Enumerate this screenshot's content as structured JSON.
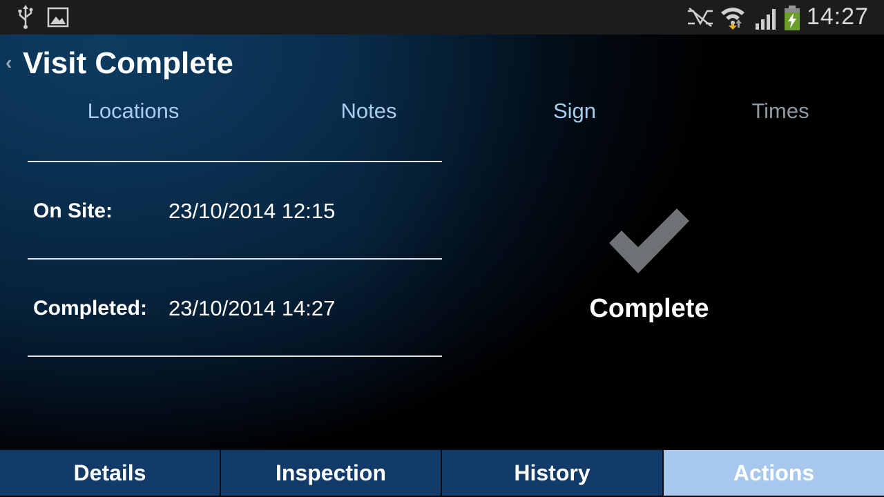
{
  "status_bar": {
    "time": "14:27",
    "icons": [
      "usb-icon",
      "image-icon",
      "nfc-muted-icon",
      "wifi-icon",
      "signal-icon",
      "battery-charging-icon"
    ]
  },
  "header": {
    "title": "Visit Complete",
    "back_glyph": "‹"
  },
  "top_tabs": [
    {
      "label": "Locations",
      "state": "enabled"
    },
    {
      "label": "Notes",
      "state": "enabled"
    },
    {
      "label": "Sign",
      "state": "enabled"
    },
    {
      "label": "Times",
      "state": "disabled"
    }
  ],
  "times": {
    "on_site": {
      "label": "On Site:",
      "value": "23/10/2014 12:15"
    },
    "completed": {
      "label": "Completed:",
      "value": "23/10/2014 14:27"
    }
  },
  "status": {
    "label": "Complete",
    "icon": "checkmark-icon"
  },
  "bottom_tabs": [
    {
      "label": "Details",
      "active": false
    },
    {
      "label": "Inspection",
      "active": false
    },
    {
      "label": "History",
      "active": false
    },
    {
      "label": "Actions",
      "active": true
    }
  ],
  "colors": {
    "accent_active_tab": "#a7c8ec",
    "bottom_tab": "#123b69",
    "top_tab_text": "#a9cdef",
    "checkmark": "#6f7275"
  }
}
